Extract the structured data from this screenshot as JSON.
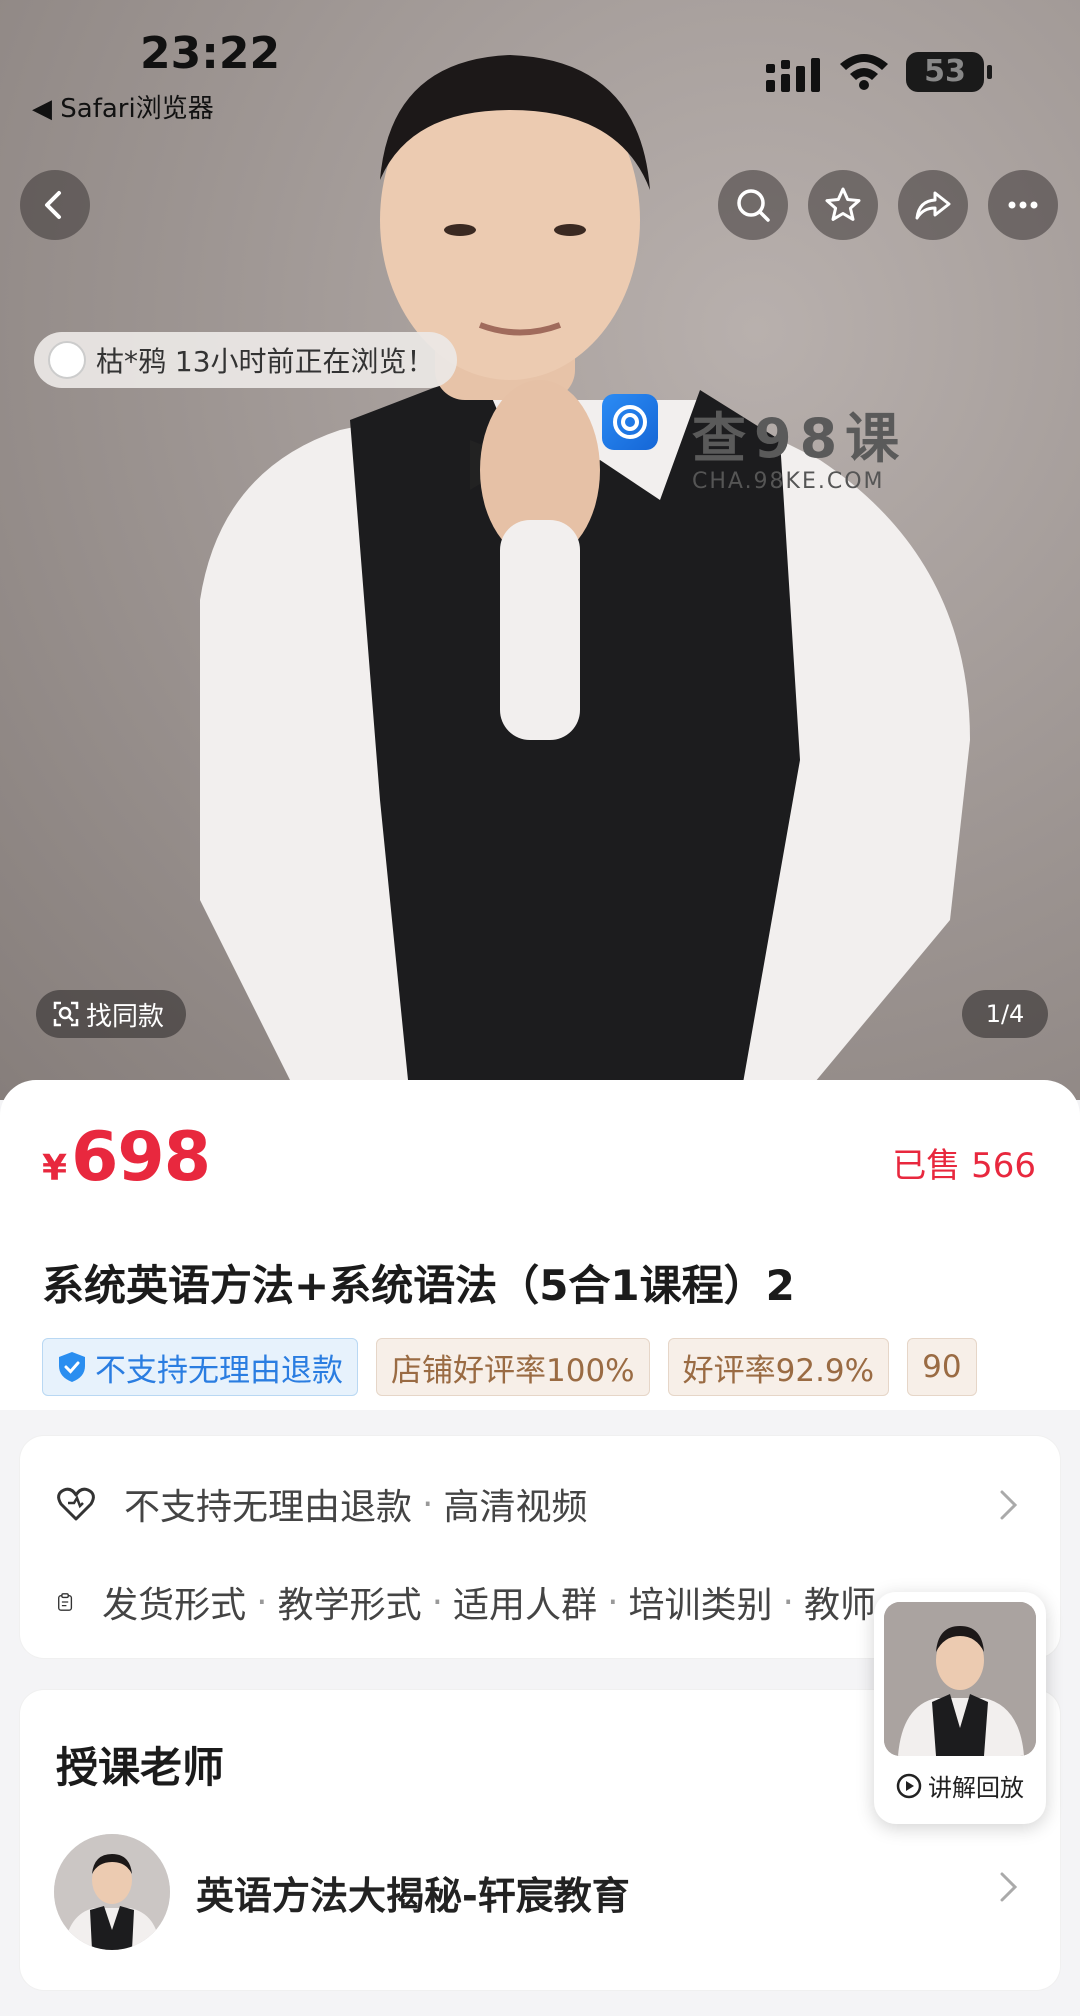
{
  "status_bar": {
    "time": "23:22",
    "back_app": "◀ Safari浏览器",
    "battery": "53"
  },
  "hero": {
    "browsing_notice": "枯*鸦 13小时前正在浏览！",
    "watermark_title": "查98课",
    "watermark_url": "CHA.98KE.COM",
    "find_same": "找同款",
    "page_indicator": "1/4"
  },
  "product": {
    "currency": "¥",
    "price": "698",
    "sold": "已售 566",
    "title": "系统英语方法+系统语法（5合1课程）2",
    "tags": [
      "不支持无理由退款",
      "店铺好评率100%",
      "好评率92.9%",
      "90"
    ]
  },
  "info": {
    "row1": [
      "不支持无理由退款",
      "高清视频"
    ],
    "row2": [
      "发货形式",
      "教学形式",
      "适用人群",
      "培训类别",
      "教师"
    ]
  },
  "teacher_section": {
    "title": "授课老师",
    "teacher_name": "英语方法大揭秘-轩宸教育"
  },
  "floating": {
    "label": "讲解回放"
  },
  "colors": {
    "price_red": "#e8283e",
    "tag_blue": "#2a7de1",
    "tag_tan": "#9a6b43"
  }
}
